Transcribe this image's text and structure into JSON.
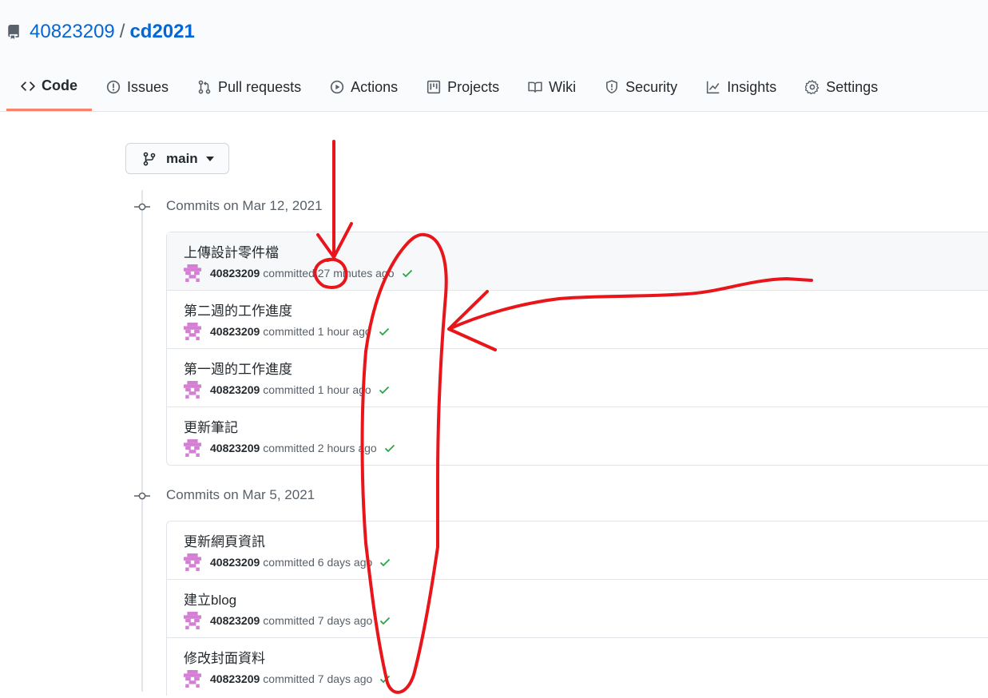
{
  "repo": {
    "owner": "40823209",
    "separator": "/",
    "name": "cd2021"
  },
  "tabs": [
    {
      "label": "Code",
      "icon": "code-icon"
    },
    {
      "label": "Issues",
      "icon": "issue-icon"
    },
    {
      "label": "Pull requests",
      "icon": "pull-request-icon"
    },
    {
      "label": "Actions",
      "icon": "play-icon"
    },
    {
      "label": "Projects",
      "icon": "project-icon"
    },
    {
      "label": "Wiki",
      "icon": "book-icon"
    },
    {
      "label": "Security",
      "icon": "shield-icon"
    },
    {
      "label": "Insights",
      "icon": "graph-icon"
    },
    {
      "label": "Settings",
      "icon": "gear-icon"
    }
  ],
  "branch": {
    "label": "main"
  },
  "groups": [
    {
      "title": "Commits on Mar 12, 2021",
      "commits": [
        {
          "message": "上傳設計零件檔",
          "author": "40823209",
          "verb": "committed",
          "time": "27 minutes ago"
        },
        {
          "message": "第二週的工作進度",
          "author": "40823209",
          "verb": "committed",
          "time": "1 hour ago"
        },
        {
          "message": "第一週的工作進度",
          "author": "40823209",
          "verb": "committed",
          "time": "1 hour ago"
        },
        {
          "message": "更新筆記",
          "author": "40823209",
          "verb": "committed",
          "time": "2 hours ago"
        }
      ]
    },
    {
      "title": "Commits on Mar 5, 2021",
      "commits": [
        {
          "message": "更新網頁資訊",
          "author": "40823209",
          "verb": "committed",
          "time": "6 days ago"
        },
        {
          "message": "建立blog",
          "author": "40823209",
          "verb": "committed",
          "time": "7 days ago"
        },
        {
          "message": "修改封面資料",
          "author": "40823209",
          "verb": "committed",
          "time": "7 days ago"
        }
      ]
    }
  ],
  "colors": {
    "link": "#0366d6",
    "accent": "#f9826c",
    "success": "#28a745",
    "annotation": "#e8151b",
    "avatar": "#d47fd4"
  }
}
